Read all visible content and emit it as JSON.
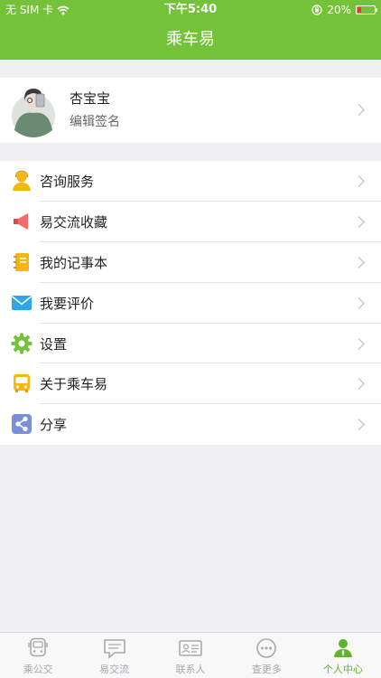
{
  "status_bar": {
    "carrier": "无 SIM 卡",
    "time": "下午5:40",
    "battery": "20%",
    "battery_level": 0.2
  },
  "header": {
    "title": "乘车易"
  },
  "profile": {
    "name": "杏宝宝",
    "signature": "编辑签名"
  },
  "menu": [
    {
      "label": "咨询服务",
      "icon": "person-service-icon",
      "color": "#f6b612"
    },
    {
      "label": "易交流收藏",
      "icon": "megaphone-icon",
      "color": "#f26a6a"
    },
    {
      "label": "我的记事本",
      "icon": "notebook-icon",
      "color": "#f6b612"
    },
    {
      "label": "我要评价",
      "icon": "mail-icon",
      "color": "#2ea7e8"
    },
    {
      "label": "设置",
      "icon": "gear-icon",
      "color": "#74c23a"
    },
    {
      "label": "关于乘车易",
      "icon": "bus-icon",
      "color": "#f6b612"
    },
    {
      "label": "分享",
      "icon": "share-icon",
      "color": "#7b8fd9"
    }
  ],
  "tabs": [
    {
      "label": "乘公交",
      "icon": "bus-icon",
      "active": false
    },
    {
      "label": "易交流",
      "icon": "chat-icon",
      "active": false
    },
    {
      "label": "联系人",
      "icon": "contact-card-icon",
      "active": false
    },
    {
      "label": "查更多",
      "icon": "more-icon",
      "active": false
    },
    {
      "label": "个人中心",
      "icon": "person-icon",
      "active": true
    }
  ],
  "colors": {
    "accent": "#74c23a",
    "tab_active": "#5fb52a",
    "tab_inactive": "#a8a8ad",
    "background": "#efeff4"
  }
}
